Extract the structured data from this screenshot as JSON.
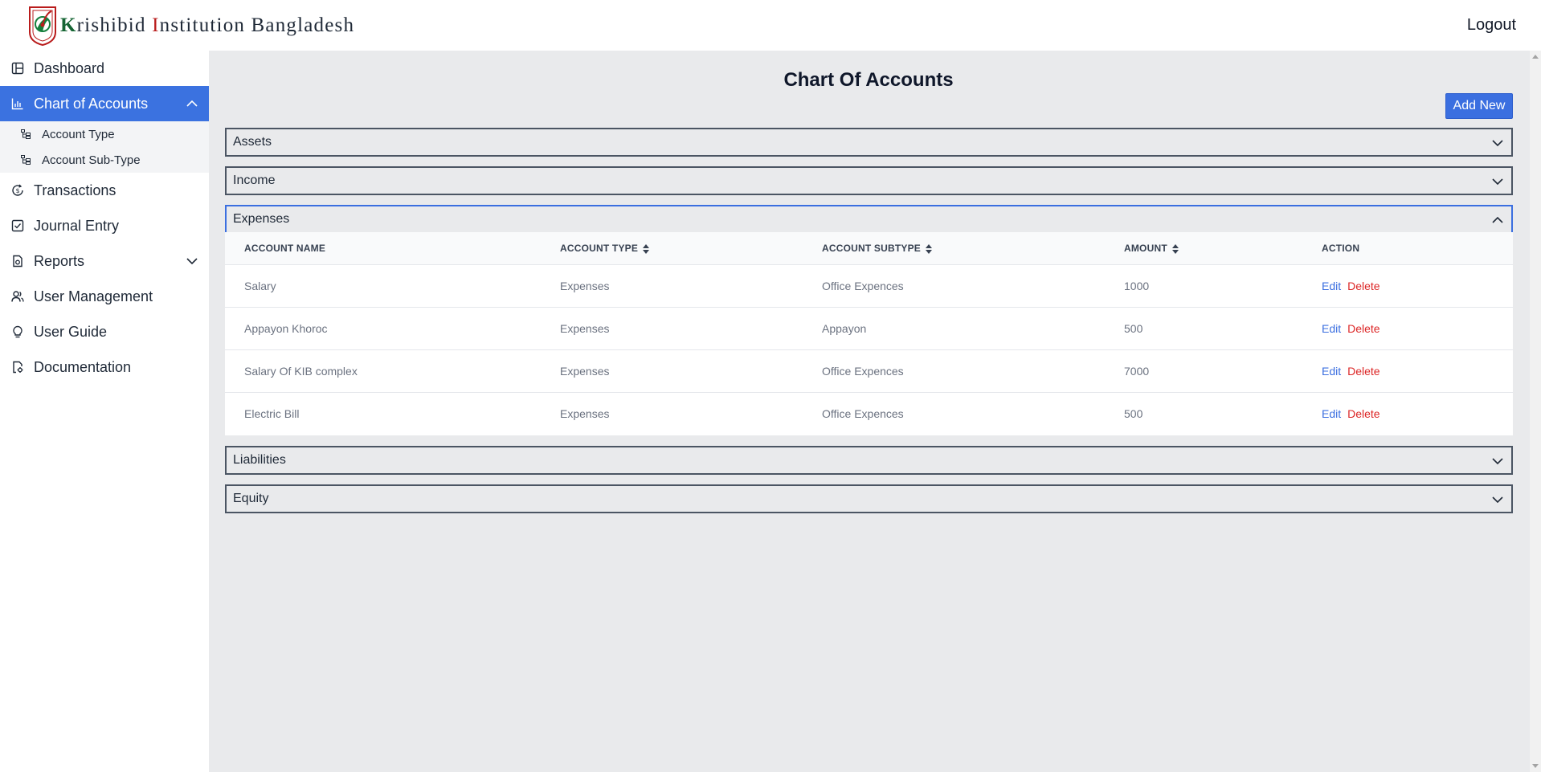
{
  "header": {
    "brand_k": "K",
    "brand_rishibid": "rishibid ",
    "brand_i": "I",
    "brand_rest": "nstitution Bangladesh",
    "logout": "Logout"
  },
  "sidebar": {
    "items": [
      {
        "label": "Dashboard",
        "icon": "dashboard-icon"
      },
      {
        "label": "Chart of Accounts",
        "icon": "bar-chart-icon",
        "active": true
      },
      {
        "label": "Transactions",
        "icon": "transactions-icon"
      },
      {
        "label": "Journal Entry",
        "icon": "journal-icon"
      },
      {
        "label": "Reports",
        "icon": "report-icon"
      },
      {
        "label": "User Management",
        "icon": "users-icon"
      },
      {
        "label": "User Guide",
        "icon": "lightbulb-icon"
      },
      {
        "label": "Documentation",
        "icon": "document-gear-icon"
      }
    ],
    "subitems": [
      {
        "label": "Account Type",
        "icon": "tree-icon"
      },
      {
        "label": "Account Sub-Type",
        "icon": "tree-icon"
      }
    ]
  },
  "main": {
    "title": "Chart Of Accounts",
    "add_new": "Add New",
    "sections": [
      "Assets",
      "Income",
      "Expenses",
      "Liabilities",
      "Equity"
    ],
    "table": {
      "columns": [
        "ACCOUNT NAME",
        "ACCOUNT TYPE",
        "ACCOUNT SUBTYPE",
        "AMOUNT",
        "ACTION"
      ],
      "rows": [
        {
          "name": "Salary",
          "type": "Expenses",
          "subtype": "Office Expences",
          "amount": "1000"
        },
        {
          "name": "Appayon Khoroc",
          "type": "Expenses",
          "subtype": "Appayon",
          "amount": "500"
        },
        {
          "name": "Salary Of KIB complex",
          "type": "Expenses",
          "subtype": "Office Expences",
          "amount": "7000"
        },
        {
          "name": "Electric Bill",
          "type": "Expenses",
          "subtype": "Office Expences",
          "amount": "500"
        }
      ],
      "edit_label": "Edit",
      "delete_label": "Delete"
    }
  },
  "colors": {
    "accent": "#3b72e0",
    "delete": "#dc2626",
    "background": "#e9eaec"
  }
}
